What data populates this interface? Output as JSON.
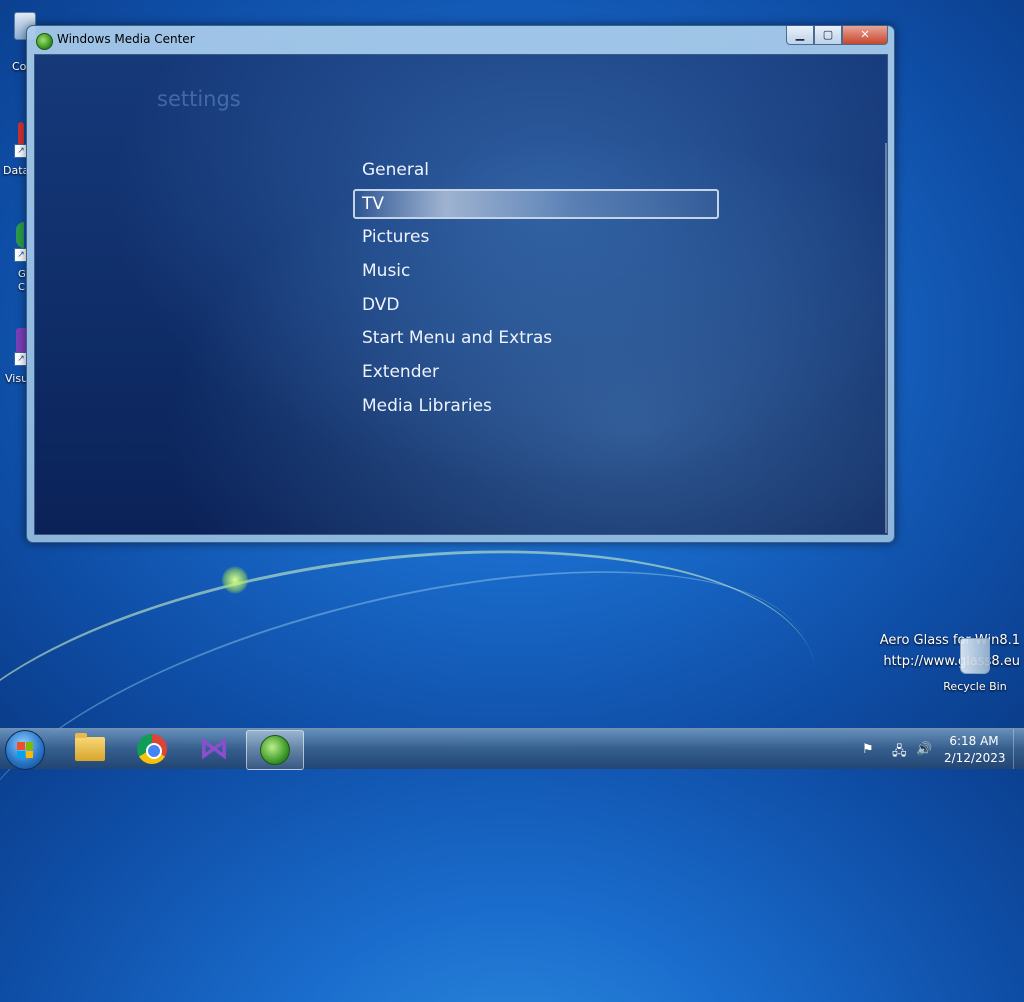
{
  "window": {
    "title": "Windows Media Center",
    "controls": {
      "minimize": "▁",
      "maximize": "▢",
      "close": "✕"
    }
  },
  "settings": {
    "heading": "settings",
    "items": [
      {
        "label": "General"
      },
      {
        "label": "TV",
        "selected": true
      },
      {
        "label": "Pictures"
      },
      {
        "label": "Music"
      },
      {
        "label": "DVD"
      },
      {
        "label": "Start Menu and Extras"
      },
      {
        "label": "Extender"
      },
      {
        "label": "Media Libraries"
      }
    ]
  },
  "desktop": {
    "icons": [
      {
        "label": "Co",
        "icon": "computer-icon"
      },
      {
        "label": "Data",
        "icon": "shortcut-icon"
      },
      {
        "label": "G\nC",
        "icon": "chrome-shortcut-icon"
      },
      {
        "label": "Visu",
        "icon": "visual-studio-shortcut-icon"
      }
    ],
    "watermark_line1": "Aero Glass for Win8.1",
    "watermark_line2": "http://www.glass8.eu",
    "recycle_bin_label": "Recycle Bin"
  },
  "taskbar": {
    "apps": [
      {
        "name": "file-explorer",
        "icon": "folder-icon"
      },
      {
        "name": "google-chrome",
        "icon": "chrome-icon"
      },
      {
        "name": "visual-studio",
        "icon": "visual-studio-icon"
      },
      {
        "name": "windows-media-center",
        "icon": "media-center-icon",
        "active": true
      }
    ],
    "tray": {
      "icons": [
        "action-center-flag-icon",
        "network-icon",
        "volume-icon"
      ],
      "time": "6:18 AM",
      "date": "2/12/2023"
    }
  },
  "colors": {
    "accent": "#1a6ccc",
    "wmc_background": "#0f2d68",
    "menu_text": "#eef3fb"
  }
}
